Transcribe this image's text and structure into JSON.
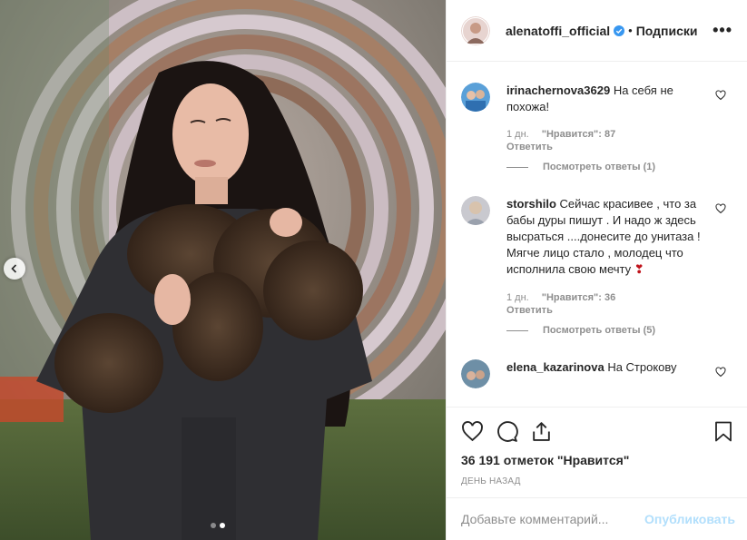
{
  "post": {
    "image_dots": 2,
    "active_dot": 1,
    "prev_icon": "chevron-left-icon"
  },
  "header": {
    "username": "alenatoffi_official",
    "verified_icon": "verified-badge-icon",
    "separator": "•",
    "follow_label": "Подписки",
    "more_label": "•••"
  },
  "comments": [
    {
      "user": "irinachernova3629",
      "text": "На себя не похожа!",
      "time": "1 дн.",
      "likes": "\"Нравится\": 87",
      "reply": "Ответить",
      "view_replies": "Посмотреть ответы (1)"
    },
    {
      "user": "storshilo",
      "text": "Сейчас красивее , что за бабы дуры пишут . И надо ж здесь высраться ....донесите до унитаза ! Мягче лицо стало , молодец что исполнила свою мечту",
      "emoji": "❣",
      "time": "1 дн.",
      "likes": "\"Нравится\": 36",
      "reply": "Ответить",
      "view_replies": "Посмотреть ответы (5)"
    },
    {
      "user": "elena_kazarinova",
      "text": "На Строкову"
    }
  ],
  "actions": {
    "like_icon": "heart-icon",
    "comment_icon": "comment-icon",
    "share_icon": "share-icon",
    "save_icon": "bookmark-icon",
    "likes_text": "36 191 отметок \"Нравится\"",
    "time_text": "ДЕНЬ НАЗАД"
  },
  "add_comment": {
    "placeholder": "Добавьте комментарий...",
    "publish_label": "Опубликовать"
  },
  "colors": {
    "verified": "#3897f0",
    "publish_disabled": "#b2dffc",
    "emoji_heart": "#c0141c"
  }
}
